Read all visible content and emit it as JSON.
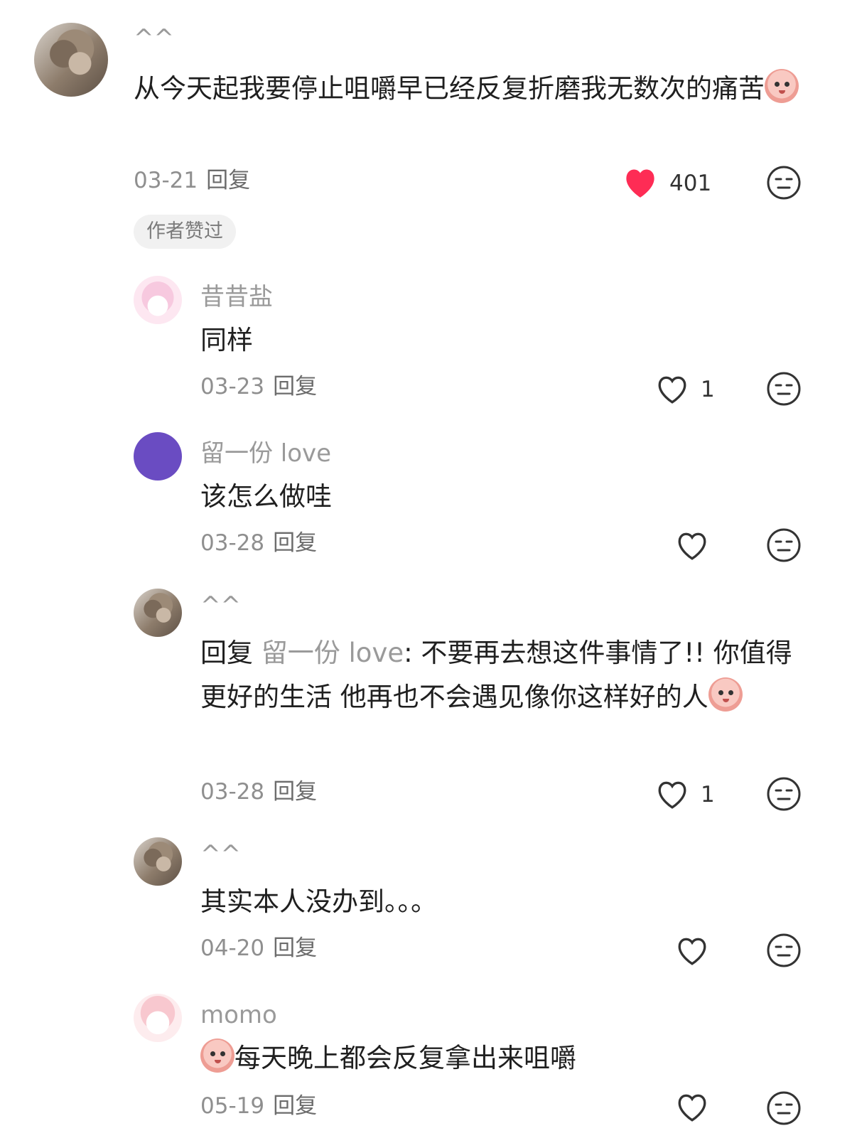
{
  "comments": [
    {
      "user": "^^",
      "text": "从今天起我要停止咀嚼早已经反复折磨我无数次的痛苦",
      "date": "03-21",
      "reply_label": "回复",
      "likes": "401",
      "liked": true,
      "badge": "作者赞过"
    }
  ],
  "replies": [
    {
      "user": "昔昔盐",
      "text": "同样",
      "date": "03-23",
      "reply_label": "回复",
      "likes": "1"
    },
    {
      "user": "留一份 love",
      "text": "该怎么做哇",
      "date": "03-28",
      "reply_label": "回复",
      "likes": ""
    },
    {
      "user": "^^",
      "reply_prefix": "回复",
      "mention": "留一份 love",
      "text": ": 不要再去想这件事情了!! 你值得更好的生活 他再也不会遇见像你这样好的人",
      "date": "03-28",
      "reply_label": "回复",
      "likes": "1"
    },
    {
      "user": "^^",
      "text": "其实本人没办到。。。",
      "date": "04-20",
      "reply_label": "回复",
      "likes": ""
    },
    {
      "user": "momo",
      "text": "每天晚上都会反复拿出来咀嚼",
      "date": "05-19",
      "reply_label": "回复",
      "likes": ""
    }
  ],
  "colors": {
    "heart_liked": "#fe2c55",
    "text": "#1f1f1f",
    "muted": "#9a9a9a"
  },
  "icons": [
    "heart-icon",
    "heart-outline-icon",
    "neutral-face-icon"
  ]
}
